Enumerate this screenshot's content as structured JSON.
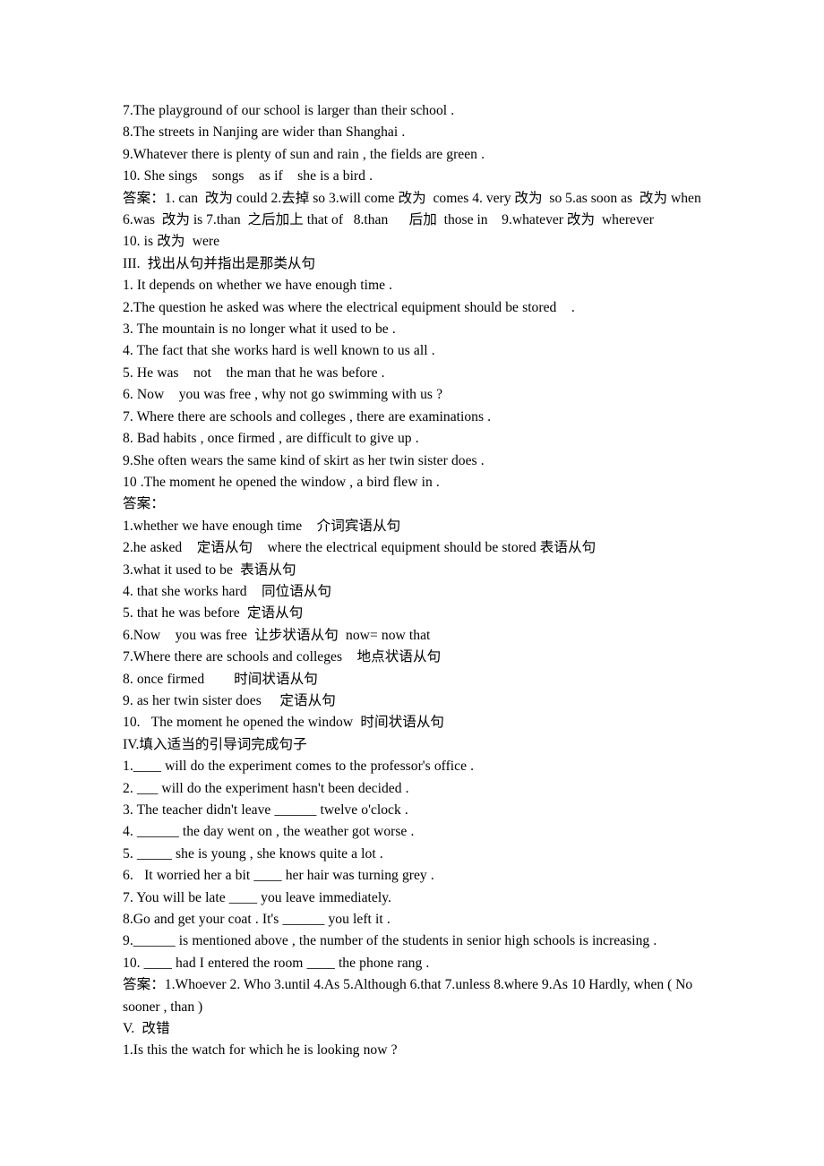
{
  "document": {
    "type": "grammar-worksheet",
    "language": "mixed-english-chinese",
    "lines": [
      "7.The playground of our school is larger than their school .",
      "8.The streets in Nanjing are wider than Shanghai .",
      "9.Whatever there is plenty of sun and rain , the fields are green .",
      "10. She sings    songs    as if    she is a bird .",
      "答案：1. can  改为 could 2.去掉 so 3.will come 改为  comes 4. very 改为  so 5.as soon as  改为 when 6.was  改为 is 7.than  之后加上 that of   8.than      后加  those in    9.whatever 改为  wherever",
      "10. is 改为  were",
      "III.  找出从句并指出是那类从句",
      "1. It depends on whether we have enough time .",
      "2.The question he asked was where the electrical equipment should be stored    .",
      "3. The mountain is no longer what it used to be .",
      "4. The fact that she works hard is well known to us all .",
      "5. He was    not    the man that he was before .",
      "6. Now    you was free , why not go swimming with us ?",
      "7. Where there are schools and colleges , there are examinations .",
      "8. Bad habits , once firmed , are difficult to give up .",
      "9.She often wears the same kind of skirt as her twin sister does .",
      "10 .The moment he opened the window , a bird flew in .",
      "答案：",
      "1.whether we have enough time    介词宾语从句",
      "2.he asked    定语从句    where the electrical equipment should be stored 表语从句",
      "3.what it used to be  表语从句",
      "4. that she works hard    同位语从句",
      "5. that he was before  定语从句",
      "6.Now    you was free  让步状语从句  now= now that",
      "7.Where there are schools and colleges    地点状语从句",
      "8. once firmed        时间状语从句",
      "9. as her twin sister does     定语从句",
      "10.   The moment he opened the window  时间状语从句",
      "IV.填入适当的引导词完成句子",
      "1.____ will do the experiment comes to the professor's office .",
      "2. ___ will do the experiment hasn't been decided .",
      "3. The teacher didn't leave ______ twelve o'clock .",
      "4. ______ the day went on , the weather got worse .",
      "5. _____ she is young , she knows quite a lot .",
      "6.   It worried her a bit ____ her hair was turning grey .",
      "7. You will be late ____ you leave immediately.",
      "8.Go and get your coat . It's ______ you left it .",
      "9.______ is mentioned above , the number of the students in senior high schools is increasing .",
      "10. ____ had I entered the room ____ the phone rang .",
      "答案：1.Whoever 2. Who 3.until 4.As 5.Although 6.that 7.unless 8.where 9.As 10 Hardly, when ( No sooner , than )",
      "V.  改错",
      "1.Is this the watch for which he is looking now ?"
    ],
    "sections": {
      "section_3_heading": "III.  找出从句并指出是那类从句",
      "section_4_heading": "IV.填入适当的引导词完成句子",
      "section_5_heading": "V.  改错",
      "answer_label": "答案："
    }
  }
}
